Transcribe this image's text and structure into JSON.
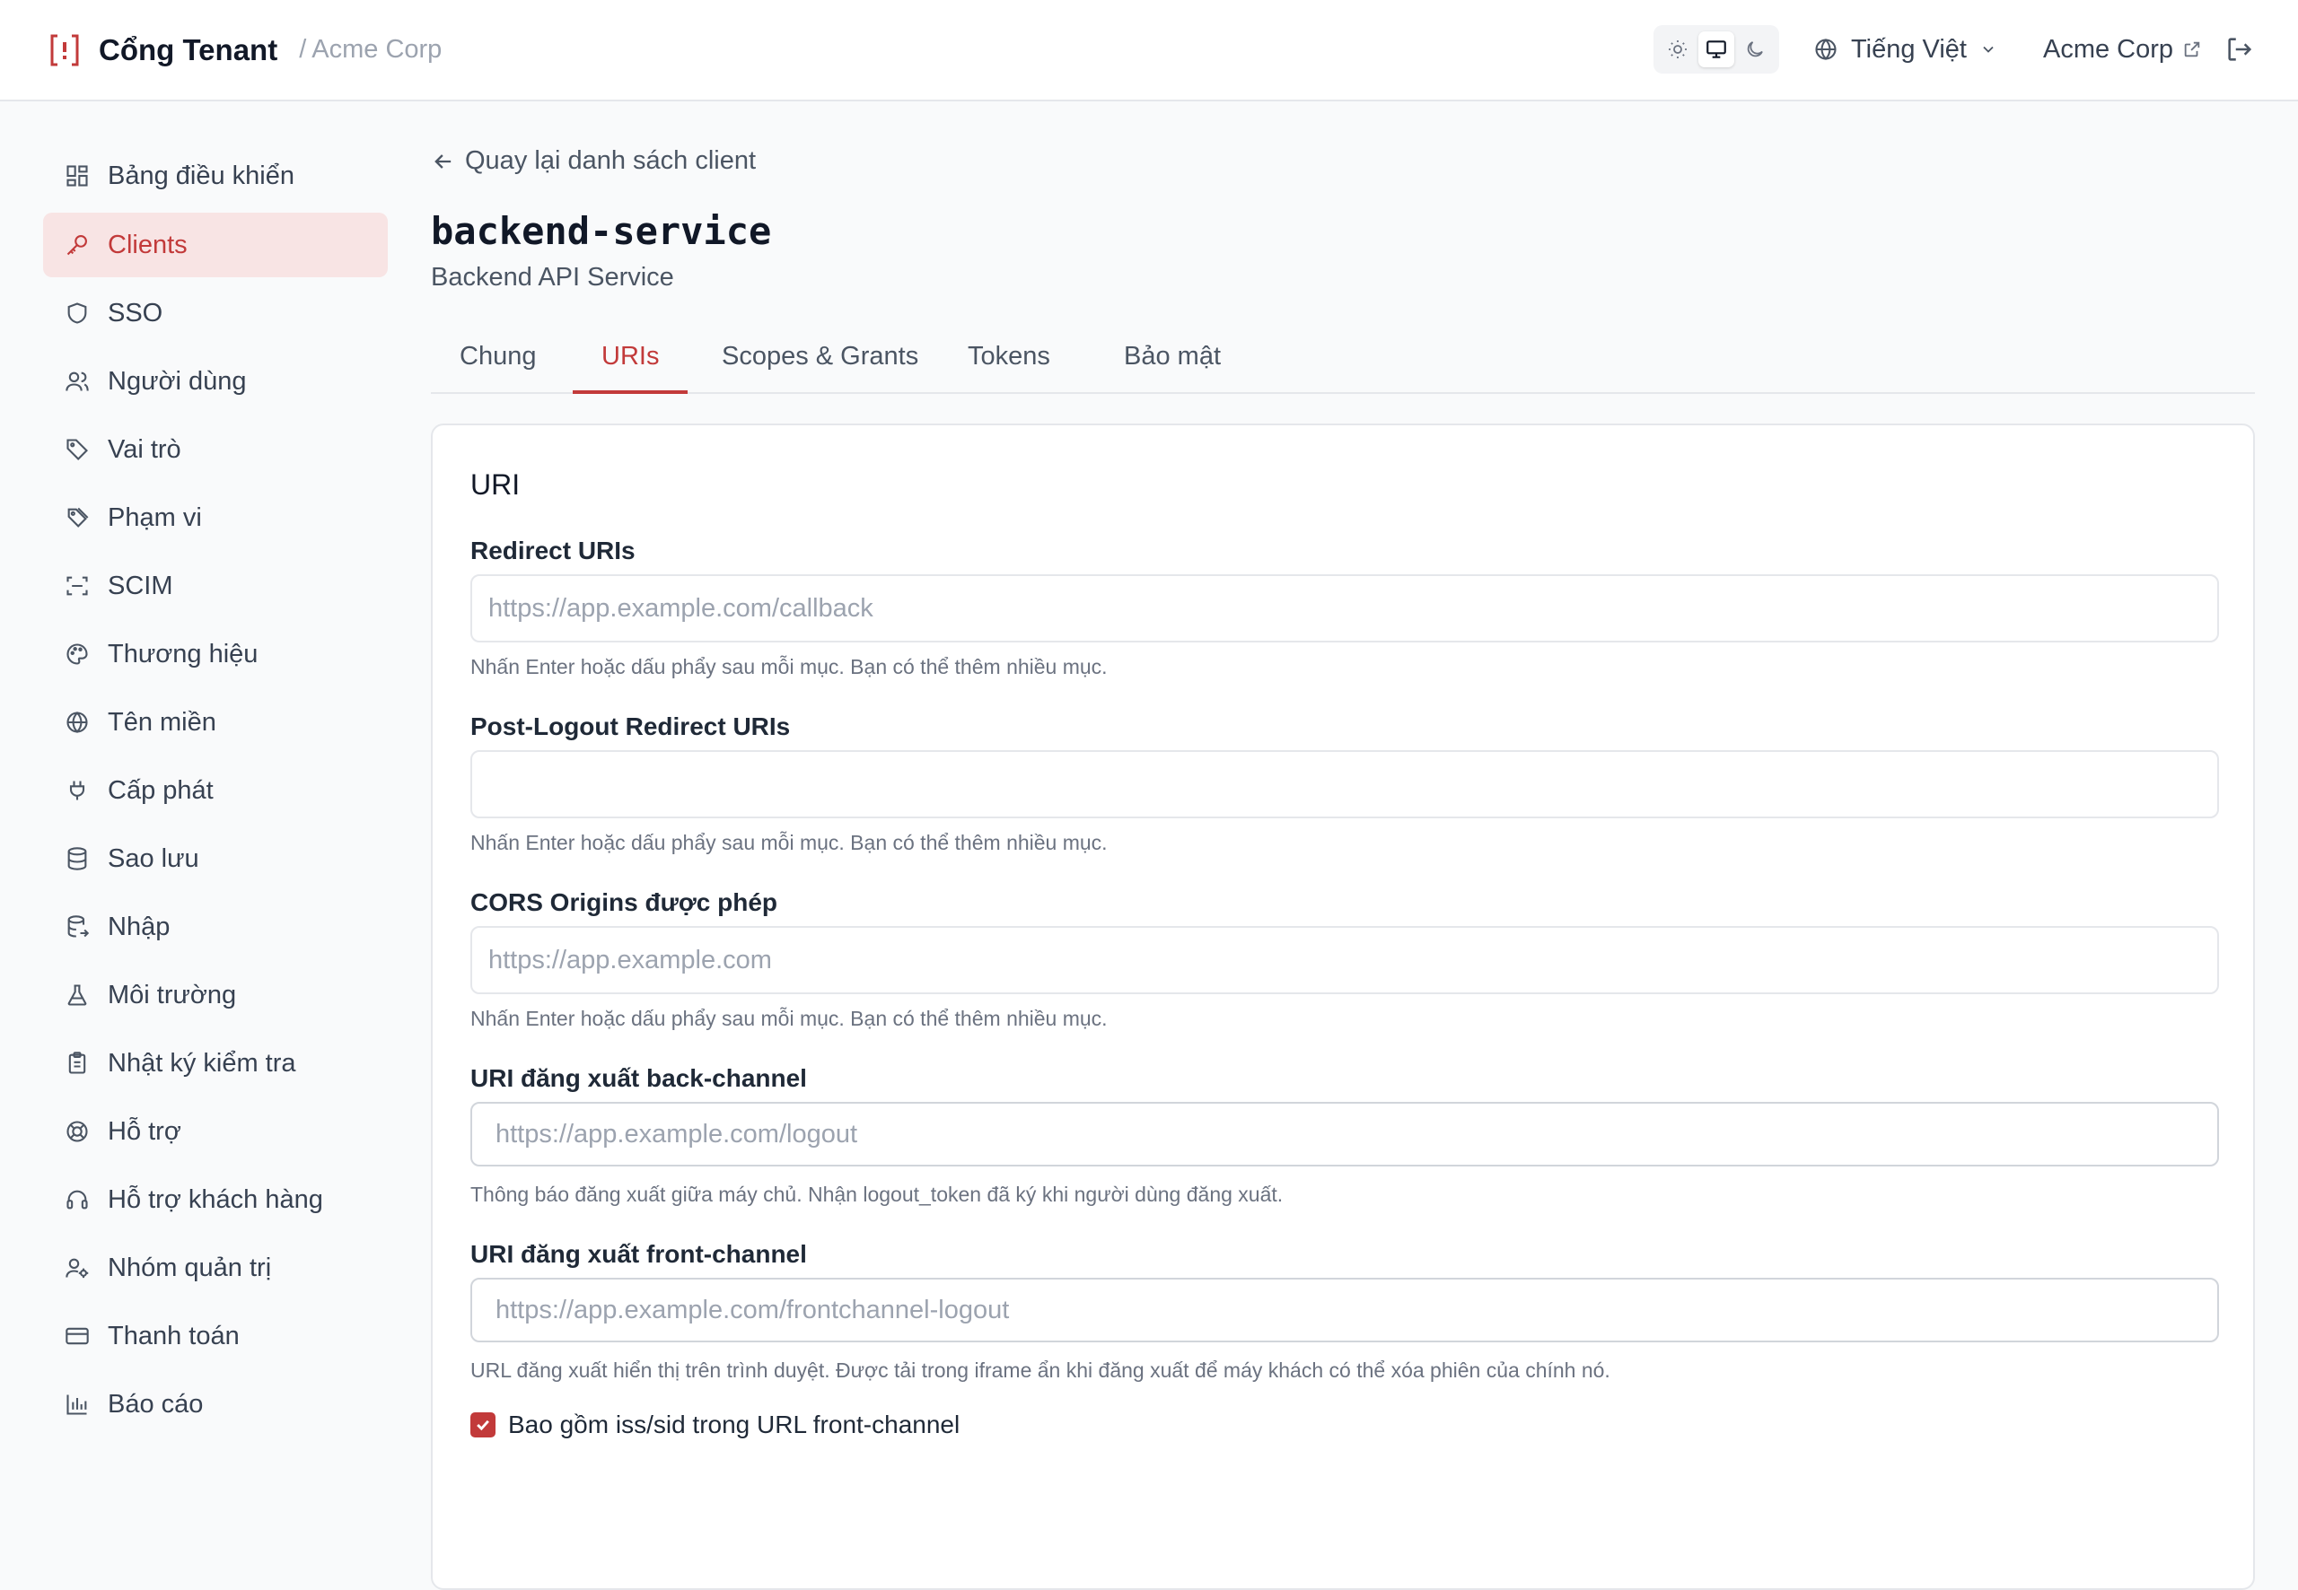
{
  "header": {
    "app_title": "Cổng Tenant",
    "separator": "/",
    "tenant": "Acme Corp",
    "language": "Tiếng Việt",
    "tenant_link": "Acme Corp",
    "theme_active": "system"
  },
  "sidebar": {
    "items": [
      {
        "label": "Bảng điều khiển",
        "icon": "dashboard-icon"
      },
      {
        "label": "Clients",
        "icon": "key-icon",
        "active": true
      },
      {
        "label": "SSO",
        "icon": "shield-icon"
      },
      {
        "label": "Người dùng",
        "icon": "users-icon"
      },
      {
        "label": "Vai trò",
        "icon": "tag-icon"
      },
      {
        "label": "Phạm vi",
        "icon": "tags-icon"
      },
      {
        "label": "SCIM",
        "icon": "scan-icon"
      },
      {
        "label": "Thương hiệu",
        "icon": "palette-icon"
      },
      {
        "label": "Tên miền",
        "icon": "globe-icon"
      },
      {
        "label": "Cấp phát",
        "icon": "plug-icon"
      },
      {
        "label": "Sao lưu",
        "icon": "database-icon"
      },
      {
        "label": "Nhập",
        "icon": "database-import-icon"
      },
      {
        "label": "Môi trường",
        "icon": "flask-icon"
      },
      {
        "label": "Nhật ký kiểm tra",
        "icon": "clipboard-icon"
      },
      {
        "label": "Hỗ trợ",
        "icon": "lifebuoy-icon"
      },
      {
        "label": "Hỗ trợ khách hàng",
        "icon": "headset-icon"
      },
      {
        "label": "Nhóm quản trị",
        "icon": "user-cog-icon"
      },
      {
        "label": "Thanh toán",
        "icon": "credit-card-icon"
      },
      {
        "label": "Báo cáo",
        "icon": "bar-chart-icon"
      }
    ]
  },
  "page": {
    "back_label": "Quay lại danh sách client",
    "title": "backend-service",
    "subtitle": "Backend API Service",
    "tabs": [
      {
        "label": "Chung"
      },
      {
        "label": "URIs",
        "active": true
      },
      {
        "label": "Scopes & Grants"
      },
      {
        "label": "Tokens"
      },
      {
        "label": "Bảo mật"
      }
    ]
  },
  "card": {
    "title": "URI",
    "fields": [
      {
        "label": "Redirect URIs",
        "placeholder": "https://app.example.com/callback",
        "help": "Nhấn Enter hoặc dấu phẩy sau mỗi mục. Bạn có thể thêm nhiều mục."
      },
      {
        "label": "Post-Logout Redirect URIs",
        "placeholder": "",
        "help": "Nhấn Enter hoặc dấu phẩy sau mỗi mục. Bạn có thể thêm nhiều mục."
      },
      {
        "label": "CORS Origins được phép",
        "placeholder": "https://app.example.com",
        "help": "Nhấn Enter hoặc dấu phẩy sau mỗi mục. Bạn có thể thêm nhiều mục."
      },
      {
        "label": "URI đăng xuất back-channel",
        "placeholder": "https://app.example.com/logout",
        "help": "Thông báo đăng xuất giữa máy chủ. Nhận logout_token đã ký khi người dùng đăng xuất."
      },
      {
        "label": "URI đăng xuất front-channel",
        "placeholder": "https://app.example.com/frontchannel-logout",
        "help": "URL đăng xuất hiển thị trên trình duyệt. Được tải trong iframe ẩn khi đăng xuất để máy khách có thể xóa phiên của chính nó."
      }
    ],
    "checkbox_label": "Bao gồm iss/sid trong URL front-channel",
    "checkbox_checked": true
  },
  "colors": {
    "accent": "#c23a3a",
    "active_bg": "#f8e4e4"
  }
}
